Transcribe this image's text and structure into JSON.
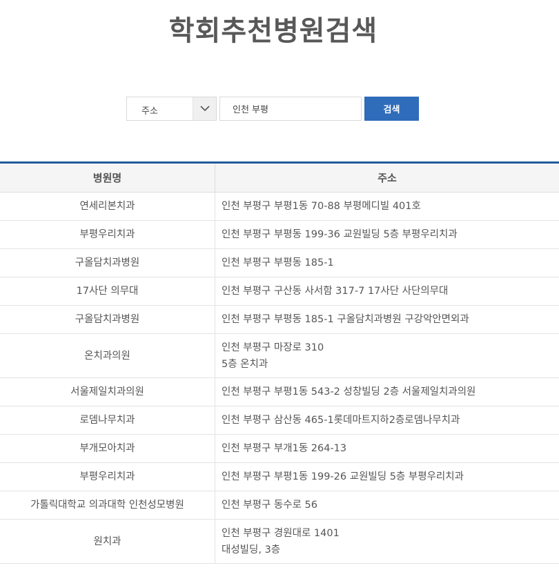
{
  "title": "학회추천병원검색",
  "search": {
    "field_selected": "주소",
    "keyword_value": "인천 부평",
    "button_label": "검색"
  },
  "table": {
    "headers": [
      "병원명",
      "주소"
    ],
    "rows": [
      {
        "name": "연세리본치과",
        "address": [
          "인천 부평구 부평1동 70-88 부평메디빌 401호"
        ]
      },
      {
        "name": "부평우리치과",
        "address": [
          "인천 부평구 부평동 199-36 교원빌딩 5층 부평우리치과"
        ]
      },
      {
        "name": "구올담치과병원",
        "address": [
          "인천 부평구 부평동 185-1"
        ]
      },
      {
        "name": "17사단 의무대",
        "address": [
          "인천 부평구 구산동 사서함 317-7 17사단 사단의무대"
        ]
      },
      {
        "name": "구올담치과병원",
        "address": [
          "인천 부평구 부평동 185-1 구올담치과병원 구강악안면외과"
        ]
      },
      {
        "name": "온치과의원",
        "address": [
          "인천 부평구 마장로 310",
          "5층 온치과"
        ]
      },
      {
        "name": "서울제일치과의원",
        "address": [
          "인천 부평구 부평1동 543-2 성창빌딩 2층 서울제일치과의원"
        ]
      },
      {
        "name": "로뎀나무치과",
        "address": [
          "인천 부평구 삼산동 465-1롯데마트지하2층로뎀나무치과"
        ]
      },
      {
        "name": "부개모아치과",
        "address": [
          "인천 부평구 부개1동 264-13"
        ]
      },
      {
        "name": "부평우리치과",
        "address": [
          "인천 부평구 부평1동 199-26 교원빌딩 5층 부평우리치과"
        ]
      },
      {
        "name": "가톨릭대학교 의과대학 인천성모병원",
        "address": [
          "인천 부평구 동수로 56"
        ]
      },
      {
        "name": "원치과",
        "address": [
          "인천 부평구 경원대로 1401",
          "대성빌딩, 3층"
        ]
      }
    ]
  }
}
